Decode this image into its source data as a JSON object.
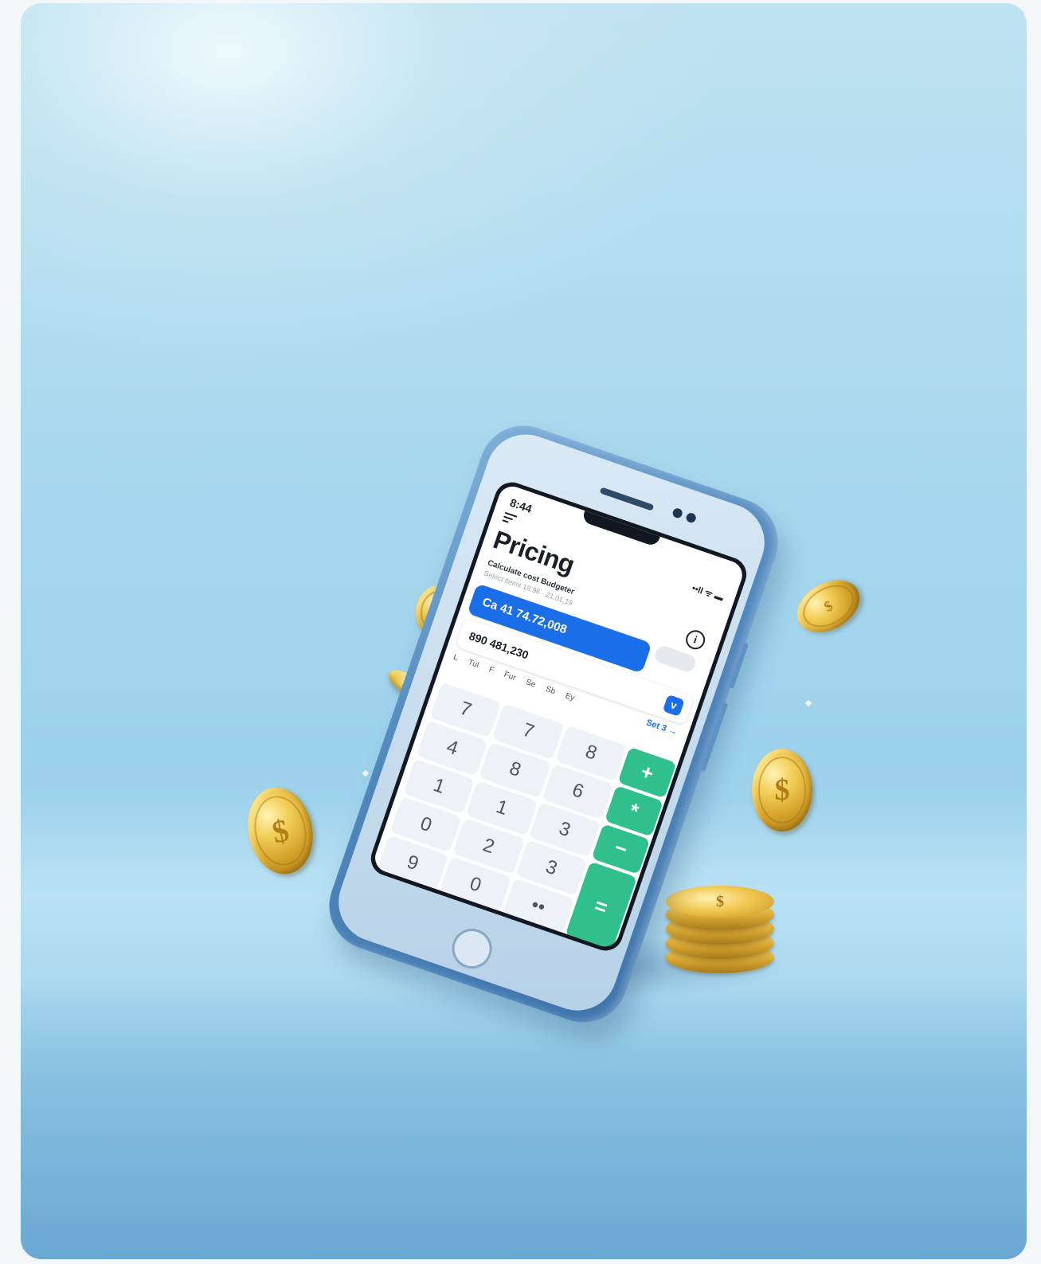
{
  "phone_app": {
    "status_time": "8:44",
    "status_icons": "••ll ᯤ ▬",
    "title": "Pricing",
    "subtitle": "Calculate cost Budgeter",
    "subtitle_detail": "Select items 18.96 · 21,01,19",
    "info_icon": "i",
    "primary_field": "Ca 41 74.72,008",
    "select_field": "890 481,230",
    "select_chevron": "v",
    "days": [
      "L",
      "Tul",
      "F",
      "Fur",
      "Se",
      "Sb",
      "Ey"
    ],
    "set_link": "Set 3 →",
    "keypad": {
      "row1": [
        "7",
        "7",
        "8",
        "+"
      ],
      "row2": [
        "4",
        "8",
        "6",
        "*"
      ],
      "row3": [
        "1",
        "1",
        "3",
        "−"
      ],
      "row4": [
        "0",
        "2",
        "3",
        "="
      ],
      "row5": [
        "9",
        "0",
        "••"
      ]
    }
  },
  "coin_symbol": "$",
  "colors": {
    "background_top": "#bfe2f1",
    "background_bottom": "#6aa8d3",
    "phone_body": "#4f87bd",
    "accent_blue": "#1a6fe8",
    "accent_green": "#2fc08e",
    "coin_gold": "#d6a42a"
  }
}
